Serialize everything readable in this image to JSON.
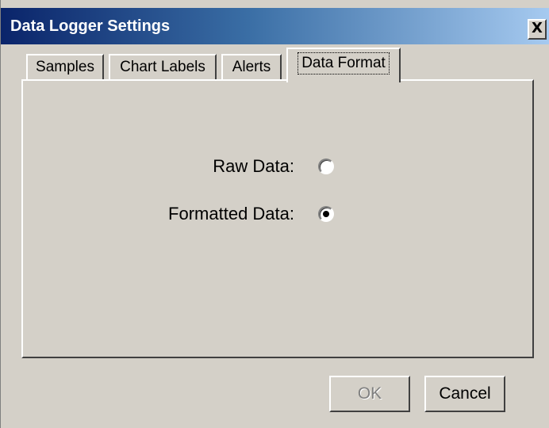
{
  "window": {
    "title": "Data Logger Settings",
    "close_glyph": "X"
  },
  "tabs": [
    {
      "label": "Samples",
      "active": false
    },
    {
      "label": "Chart Labels",
      "active": false
    },
    {
      "label": "Alerts",
      "active": false
    },
    {
      "label": "Data Format",
      "active": true
    }
  ],
  "data_format": {
    "options": [
      {
        "label": "Raw Data:",
        "selected": false
      },
      {
        "label": "Formatted Data:",
        "selected": true
      }
    ]
  },
  "buttons": {
    "ok_label": "OK",
    "ok_enabled": false,
    "cancel_label": "Cancel"
  },
  "colors": {
    "face": "#d4d0c8",
    "title_start": "#0a246a",
    "title_end": "#a6caf0"
  }
}
